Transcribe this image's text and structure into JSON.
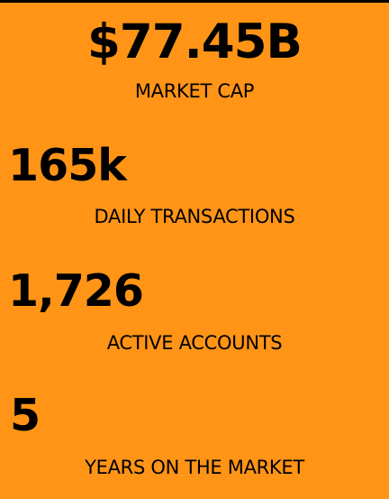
{
  "stats": [
    {
      "value": "$77.45B",
      "label": "MARKET CAP"
    },
    {
      "value": "165k",
      "label": "DAILY TRANSACTIONS"
    },
    {
      "value": "1,726",
      "label": "ACTIVE ACCOUNTS"
    },
    {
      "value": "5",
      "label": "YEARS ON THE MARKET"
    }
  ],
  "colors": {
    "background": "#ff9417",
    "text": "#000000",
    "top_border": "#000000"
  }
}
